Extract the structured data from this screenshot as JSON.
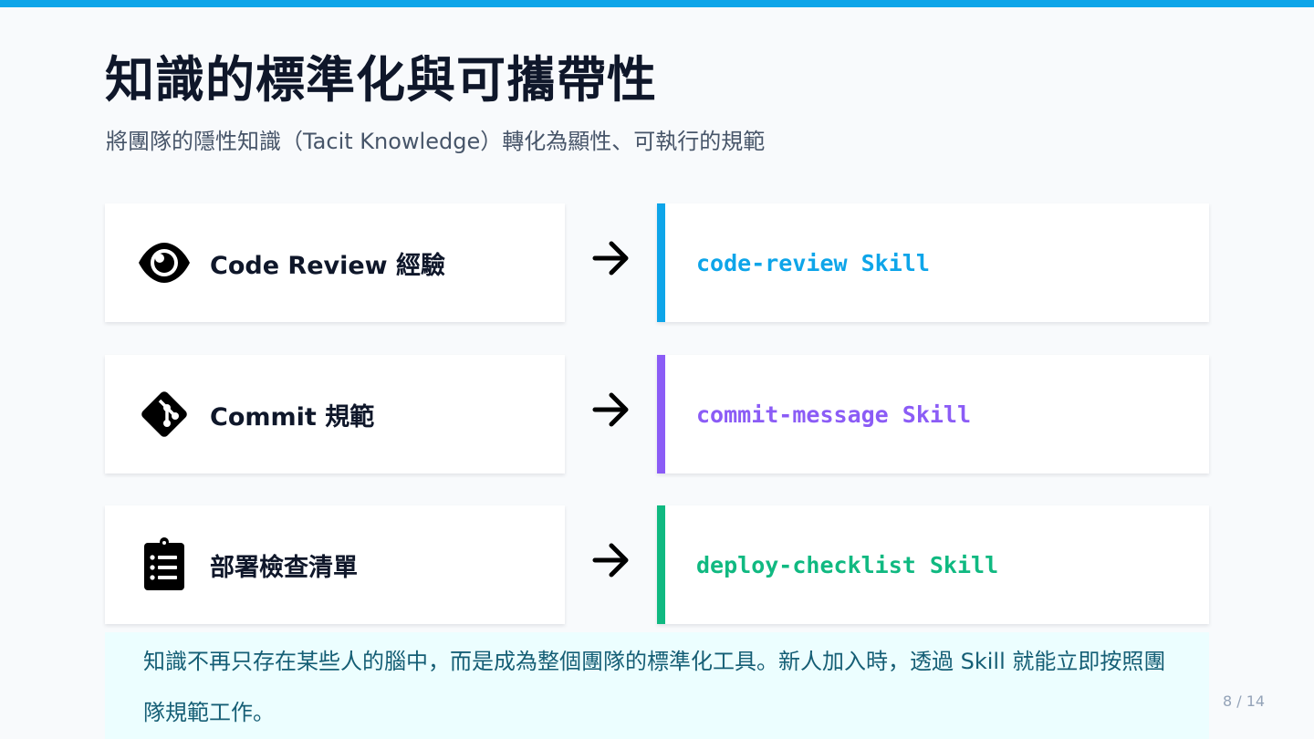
{
  "slide": {
    "title": "知識的標準化與可攜帶性",
    "subtitle": "將團隊的隱性知識（Tacit Knowledge）轉化為顯性、可執行的規範",
    "page_number": "8 / 14",
    "accent_color": "#0ea5e9"
  },
  "mappings": [
    {
      "source_label": "Code Review 經驗",
      "source_icon": "eye-icon",
      "arrow_icon": "arrow-right-icon",
      "target_label": "code-review Skill",
      "target_color": "#0ea5e9"
    },
    {
      "source_label": "Commit 規範",
      "source_icon": "git-icon",
      "arrow_icon": "arrow-right-icon",
      "target_label": "commit-message Skill",
      "target_color": "#8b5cf6"
    },
    {
      "source_label": "部署檢查清單",
      "source_icon": "clipboard-list-icon",
      "arrow_icon": "arrow-right-icon",
      "target_label": "deploy-checklist Skill",
      "target_color": "#10b981"
    }
  ],
  "note": {
    "text": "知識不再只存在某些人的腦中，而是成為整個團隊的標準化工具。新人加入時，透過 Skill 就能立即按照團隊規範工作。"
  }
}
